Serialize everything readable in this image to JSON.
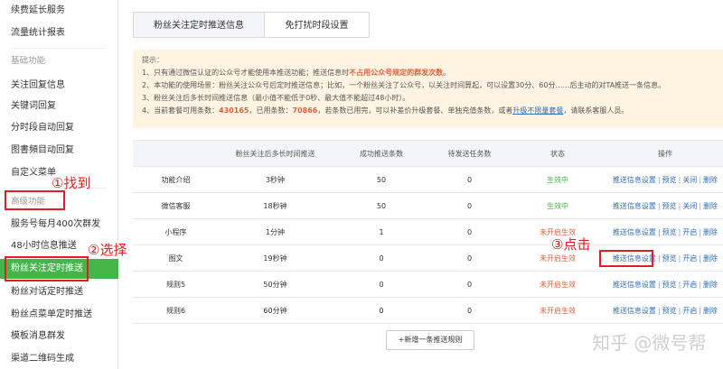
{
  "sidebar": {
    "items": [
      {
        "label": "续费延长服务",
        "type": "item"
      },
      {
        "label": "流量统计报表",
        "type": "item"
      },
      {
        "label": "基础功能",
        "type": "group"
      },
      {
        "label": "关注回复信息",
        "type": "item"
      },
      {
        "label": "关键词回复",
        "type": "item"
      },
      {
        "label": "分时段自动回复",
        "type": "item"
      },
      {
        "label": "图書頻目动回复",
        "type": "item"
      },
      {
        "label": "自定义菜单",
        "type": "item"
      },
      {
        "label": "高级功能",
        "type": "group"
      },
      {
        "label": "服务号每月400次群发",
        "type": "item"
      },
      {
        "label": "48小时信息推送",
        "type": "item"
      },
      {
        "label": "粉丝关注定时推送",
        "type": "active"
      },
      {
        "label": "粉丝对话定时推送",
        "type": "item"
      },
      {
        "label": "粉丝点菜单定时推送",
        "type": "item"
      },
      {
        "label": "模板消息群发",
        "type": "item"
      },
      {
        "label": "渠道二维码生成",
        "type": "item"
      }
    ]
  },
  "tabs": [
    {
      "label": "粉丝关注定时推送信息",
      "active": true
    },
    {
      "label": "免打扰时段设置",
      "active": false
    }
  ],
  "notice": {
    "title": "提示：",
    "line1_a": "1、只有通过微信认证的公众号才能使用本推送功能；推送信息时",
    "line1_red": "不占用公众号规定的群发次数",
    "line1_b": "。",
    "line2": "2、本功能的使用场景：粉丝关注公众号后定时推送信息；比如，一个粉丝关注了公众号，以关注时间算起，可以设置30分、60分……后主动的对TA推送一条信息。",
    "line3": "3、粉丝关注后多长时间推送信息（最小值不能低于0秒、最大值不能超过48小时）。",
    "line4_a": "4、当前套餐可用条数：",
    "line4_num1": "430165",
    "line4_b": "，已用条数：",
    "line4_num2": "70866",
    "line4_c": "，若条数已用完，可以补差价升级套餐、单独充值条数，或者",
    "line4_link": "升级不限量套餐",
    "line4_d": "，请联系客服人员。"
  },
  "table": {
    "headers": [
      "",
      "粉丝关注后多长时间推送",
      "成功推送条数",
      "待发送任务数",
      "状态",
      "操作"
    ],
    "rows": [
      {
        "name": "功能介绍",
        "delay": "3秒钟",
        "success": "50",
        "pending": "0",
        "status": "生效中",
        "on": true,
        "ops": [
          "推送信息设置",
          "预览",
          "关闭",
          "删除"
        ]
      },
      {
        "name": "微信客服",
        "delay": "18秒钟",
        "success": "50",
        "pending": "0",
        "status": "生效中",
        "on": true,
        "ops": [
          "推送信息设置",
          "预览",
          "关闭",
          "删除"
        ]
      },
      {
        "name": "小程序",
        "delay": "1分钟",
        "success": "1",
        "pending": "0",
        "status": "未开启生效",
        "on": false,
        "ops": [
          "推送信息设置",
          "预览",
          "开启",
          "删除"
        ]
      },
      {
        "name": "图文",
        "delay": "19秒钟",
        "success": "0",
        "pending": "0",
        "status": "未开启生效",
        "on": false,
        "ops": [
          "推送信息设置",
          "预览",
          "开启",
          "删除"
        ]
      },
      {
        "name": "规则5",
        "delay": "50分钟",
        "success": "0",
        "pending": "0",
        "status": "未开启生效",
        "on": false,
        "ops": [
          "推送信息设置",
          "预览",
          "开启",
          "删除"
        ]
      },
      {
        "name": "规则6",
        "delay": "60分钟",
        "success": "0",
        "pending": "0",
        "status": "未开启生效",
        "on": false,
        "ops": [
          "推送信息设置",
          "预览",
          "开启",
          "删除"
        ]
      }
    ],
    "add_button": "+新增一条推送规则"
  },
  "annotations": {
    "step1": "①找到",
    "step2": "②选择",
    "step3": "③点击"
  },
  "watermark": "知乎 @微号帮",
  "colors": {
    "accent": "#44b549",
    "warn": "#e15f3a",
    "link": "#2f6fb5",
    "annotation": "#e02020"
  }
}
